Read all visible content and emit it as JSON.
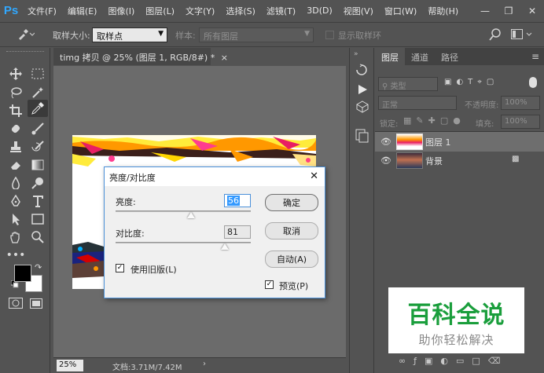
{
  "app": {
    "logo": "Ps",
    "menu": [
      "文件(F)",
      "编辑(E)",
      "图像(I)",
      "图层(L)",
      "文字(Y)",
      "选择(S)",
      "滤镜(T)",
      "3D(D)",
      "视图(V)",
      "窗口(W)",
      "帮助(H)"
    ]
  },
  "options": {
    "sample_size_label": "取样大小:",
    "sample_size_value": "取样点",
    "sample_label": "样本:",
    "sample_value": "所有图层",
    "show_ring_label": "显示取样环"
  },
  "document": {
    "tab_title": "timg 拷贝 @ 25% (图层 1, RGB/8#) *",
    "zoom": "25%",
    "doc_size": "文档:3.71M/7.42M"
  },
  "dialog": {
    "title": "亮度/对比度",
    "brightness_label": "亮度:",
    "brightness_value": "56",
    "contrast_label": "对比度:",
    "contrast_value": "81",
    "legacy_label": "使用旧版(L)",
    "legacy_checked": true,
    "ok_label": "确定",
    "cancel_label": "取消",
    "auto_label": "自动(A)",
    "preview_label": "预览(P)",
    "preview_checked": true,
    "brightness_slider": 0.56,
    "contrast_slider": 0.81
  },
  "layers_panel": {
    "tabs": [
      "图层",
      "通道",
      "路径"
    ],
    "filter_label": "类型",
    "blend_mode": "正常",
    "opacity_label": "不透明度:",
    "opacity_value": "100%",
    "lock_label": "锁定:",
    "fill_label": "填充:",
    "fill_value": "100%",
    "layers": [
      {
        "name": "图层 1",
        "selected": true,
        "locked": false
      },
      {
        "name": "背景",
        "selected": false,
        "locked": true
      }
    ]
  },
  "watermark": {
    "title": "百科全说",
    "subtitle": "助你轻松解决"
  },
  "colors": {
    "brand": "#31a8ff",
    "watermark_green": "#1a9e3c",
    "watermark_gray": "#888888"
  }
}
